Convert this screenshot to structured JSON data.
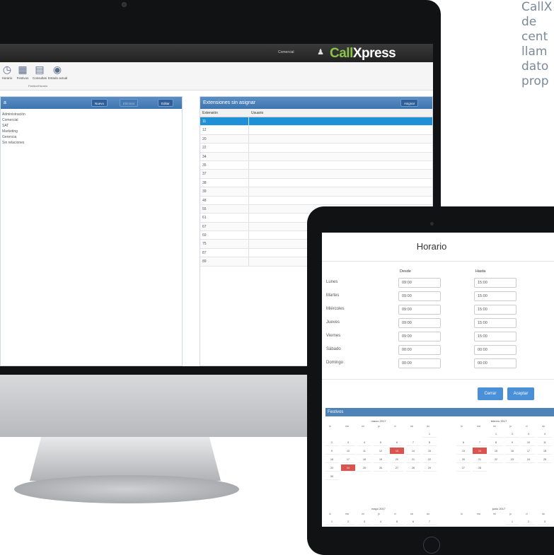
{
  "side_text": [
    "CallX",
    "de",
    "cent",
    "llam",
    "dato",
    "prop"
  ],
  "header": {
    "user_label": "Comercial",
    "brand_call": "Call",
    "brand_xpress": "Xpress"
  },
  "toolbar": {
    "buttons": [
      {
        "label": "Horario",
        "icon": "clock-icon"
      },
      {
        "label": "Festivos",
        "icon": "calendar-icon"
      },
      {
        "label": "Consultas",
        "icon": "document-icon"
      },
      {
        "label": "Estado actual",
        "icon": "globe-icon"
      }
    ],
    "group_label": "Festivo/Horario"
  },
  "left_panel": {
    "title": "a",
    "buttons": [
      "Nuevo",
      "Eliminar",
      "Editar"
    ],
    "tree_items": [
      "",
      "Administración",
      "Comercial",
      "SAT",
      "Marketing",
      "",
      "Gerencia",
      "Sin relaciones"
    ]
  },
  "right_panel": {
    "title": "Extensiones sin asignar",
    "assign_button": "Asignar",
    "columns": [
      "Extensión",
      "Usuario"
    ],
    "rows": [
      "11",
      "12",
      "20",
      "22",
      "34",
      "35",
      "37",
      "38",
      "39",
      "48",
      "55",
      "61",
      "67",
      "69",
      "75",
      "87",
      "89"
    ],
    "selected_index": 0
  },
  "tablet": {
    "title": "Horario",
    "col_desde": "Desde",
    "col_hasta": "Hasta",
    "days": [
      {
        "day": "Lunes",
        "desde": "09:00",
        "hasta": "15:00"
      },
      {
        "day": "Martes",
        "desde": "09:00",
        "hasta": "15:00"
      },
      {
        "day": "Miércoles",
        "desde": "09:00",
        "hasta": "15:00"
      },
      {
        "day": "Jueves",
        "desde": "09:00",
        "hasta": "15:00"
      },
      {
        "day": "Viernes",
        "desde": "09:00",
        "hasta": "15:00"
      },
      {
        "day": "Sábado",
        "desde": "00:00",
        "hasta": "00:00"
      },
      {
        "day": "Domingo",
        "desde": "00:00",
        "hasta": "00:00"
      }
    ],
    "btn_cerrar": "Cerrar",
    "btn_aceptar": "Aceptar",
    "festivos_title": "Festivos",
    "cal_month_1": "marzo 2017",
    "cal_month_2": "febrero 2017",
    "cal_month_3": "mayo 2017",
    "cal_month_4": "junio 2017",
    "dows": [
      "lu",
      "ma",
      "mi",
      "ju",
      "vi",
      "sá",
      "do"
    ]
  },
  "colors": {
    "accent": "#4a90d9",
    "selected_row": "#1e90d8",
    "holiday": "#d9534f",
    "brand_green": "#8bc34a"
  }
}
